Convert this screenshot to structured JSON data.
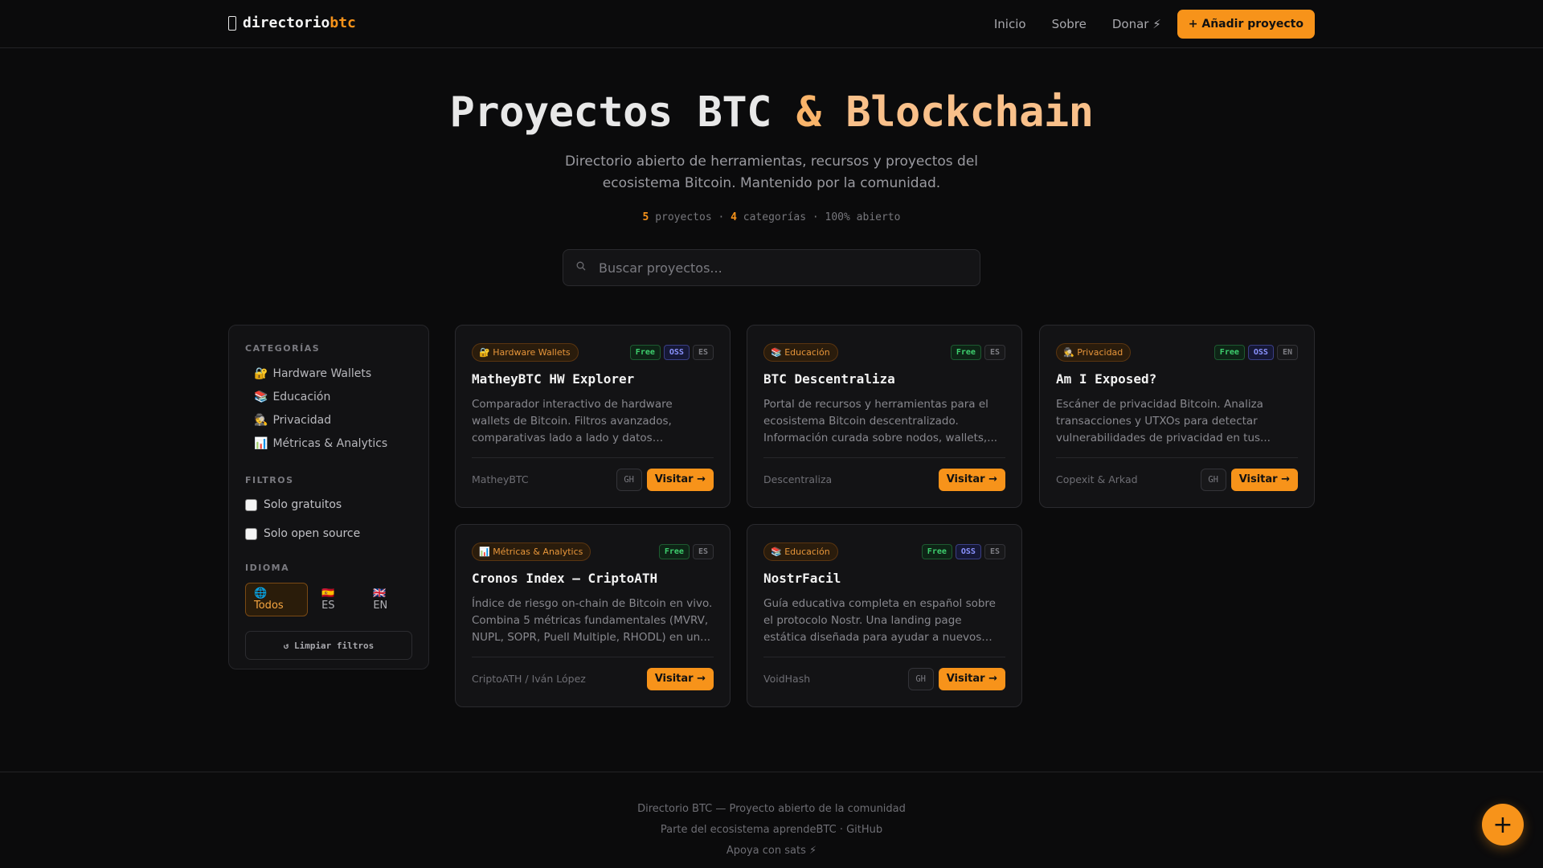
{
  "nav": {
    "brand_icon": "wallet-icon",
    "brand_part1": "directorio",
    "brand_part2": "btc",
    "links": [
      "Inicio",
      "Sobre",
      "Donar ⚡"
    ],
    "cta": "+ Añadir proyecto"
  },
  "hero": {
    "title_part1": "Proyectos BTC ",
    "title_amp": "&",
    "title_part2": " Blockchain",
    "subtitle": "Directorio abierto de herramientas, recursos y proyectos del ecosistema Bitcoin. Mantenido por la comunidad.",
    "stats": {
      "projects_count": "5",
      "projects_label": " proyectos · ",
      "categories_count": "4",
      "categories_label": " categorías · 100% abierto"
    }
  },
  "search": {
    "icon": "search-icon",
    "placeholder": "Buscar proyectos..."
  },
  "sidebar": {
    "categories_title": "CATEGORÍAS",
    "categories": [
      {
        "icon": "🔐",
        "label": "Hardware Wallets"
      },
      {
        "icon": "📚",
        "label": "Educación"
      },
      {
        "icon": "🕵️",
        "label": "Privacidad"
      },
      {
        "icon": "📊",
        "label": "Métricas & Analytics"
      }
    ],
    "filters_title": "FILTROS",
    "filters": [
      "Solo gratuitos",
      "Solo open source"
    ],
    "language_title": "IDIOMA",
    "languages": [
      "🌐 Todos",
      "🇪🇸 ES",
      "🇬🇧 EN"
    ],
    "active_language": "🌐 Todos",
    "clear_label": "↺ Limpiar filtros"
  },
  "cards": [
    {
      "category": "🔐 Hardware Wallets",
      "tags": [
        "Free",
        "OSS",
        "ES"
      ],
      "title": "MatheyBTC HW Explorer",
      "description": "Comparador interactivo de hardware wallets de Bitcoin. Filtros avanzados, comparativas lado a lado y datos actualizados...",
      "author": "MatheyBTC",
      "github": "GH",
      "visit": "Visitar →"
    },
    {
      "category": "📚 Educación",
      "tags": [
        "Free",
        "ES"
      ],
      "title": "BTC Descentraliza",
      "description": "Portal de recursos y herramientas para el ecosistema Bitcoin descentralizado. Información curada sobre nodos, wallets,...",
      "author": "Descentraliza",
      "github": "",
      "visit": "Visitar →"
    },
    {
      "category": "🕵️ Privacidad",
      "tags": [
        "Free",
        "OSS",
        "EN"
      ],
      "title": "Am I Exposed?",
      "description": "Escáner de privacidad Bitcoin. Analiza transacciones y UTXOs para detectar vulnerabilidades de privacidad en tus...",
      "author": "Copexit & Arkad",
      "github": "GH",
      "visit": "Visitar →"
    },
    {
      "category": "📊 Métricas & Analytics",
      "tags": [
        "Free",
        "ES"
      ],
      "title": "Cronos Index — CriptoATH",
      "description": "Índice de riesgo on-chain de Bitcoin en vivo. Combina 5 métricas fundamentales (MVRV, NUPL, SOPR, Puell Multiple, RHODL) en un...",
      "author": "CriptoATH / Iván López",
      "github": "",
      "visit": "Visitar →"
    },
    {
      "category": "📚 Educación",
      "tags": [
        "Free",
        "OSS",
        "ES"
      ],
      "title": "NostrFacil",
      "description": "Guía educativa completa en español sobre el protocolo Nostr. Una landing page estática diseñada para ayudar a nuevos usuarios a...",
      "author": "VoidHash",
      "github": "GH",
      "visit": "Visitar →"
    }
  ],
  "footer": {
    "line1": "Directorio BTC — Proyecto abierto de la comunidad",
    "line2": "Parte del ecosistema aprendeBTC · GitHub",
    "line3": "Apoya con sats ⚡"
  },
  "fab": "+",
  "colors": {
    "accent": "#f7931a",
    "background": "#0b0b0c",
    "free": "#3ecf6e",
    "oss": "#8b93ff"
  }
}
